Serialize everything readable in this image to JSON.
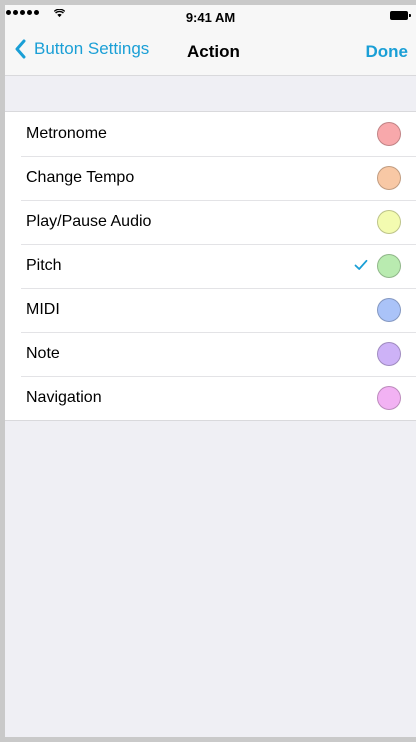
{
  "status_bar": {
    "time": "9:41 AM"
  },
  "nav_bar": {
    "back_label": "Button Settings",
    "title": "Action",
    "done_label": "Done"
  },
  "actions": [
    {
      "label": "Metronome",
      "color": "#f8a8ab",
      "selected": false
    },
    {
      "label": "Change Tempo",
      "color": "#f8c8a5",
      "selected": false
    },
    {
      "label": "Play/Pause Audio",
      "color": "#f3fbb0",
      "selected": false
    },
    {
      "label": "Pitch",
      "color": "#b9ebb0",
      "selected": true
    },
    {
      "label": "MIDI",
      "color": "#aac3f8",
      "selected": false
    },
    {
      "label": "Note",
      "color": "#cdb2f7",
      "selected": false
    },
    {
      "label": "Navigation",
      "color": "#f2b2f3",
      "selected": false
    }
  ],
  "icons": {
    "back": "chevron-left-icon",
    "check": "checkmark-icon",
    "wifi": "wifi-icon",
    "battery": "battery-icon"
  },
  "colors": {
    "accent": "#1a9fd6",
    "background": "#efeff4"
  }
}
